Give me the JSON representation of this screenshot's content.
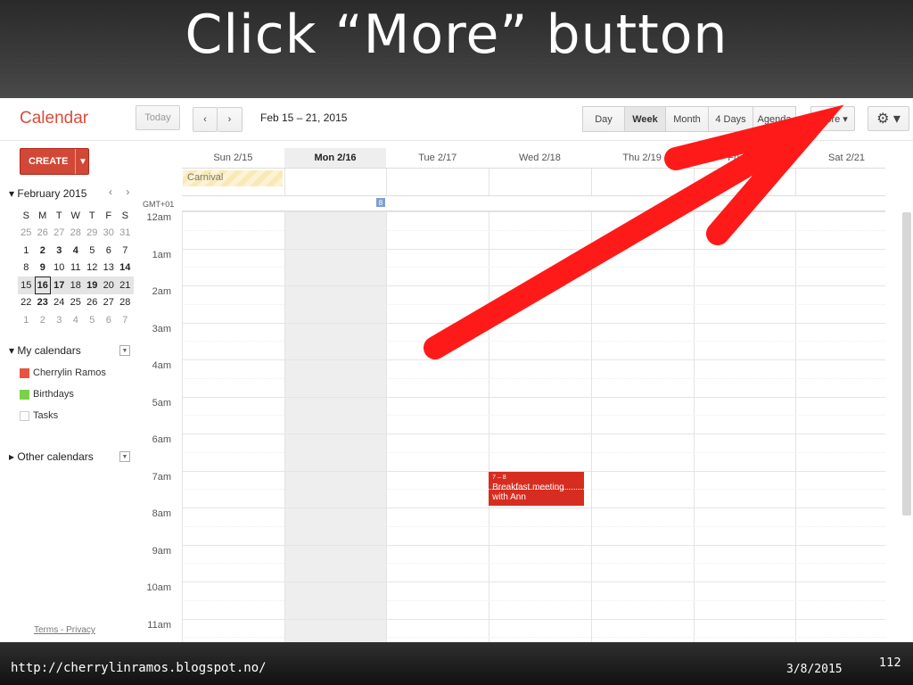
{
  "slide": {
    "title": "Click “More” button",
    "footer_url": "http://cherrylinramos.blogspot.no/",
    "footer_date": "3/8/2015",
    "page_number": "112"
  },
  "app": {
    "name": "Calendar",
    "today_label": "Today",
    "prev_icon": "‹",
    "next_icon": "›",
    "date_range": "Feb 15 – 21, 2015",
    "views": [
      "Day",
      "Week",
      "Month",
      "4 Days",
      "Agenda"
    ],
    "active_view": "Week",
    "more_label": "More ▾",
    "settings_icon": "⚙ ▾"
  },
  "sidebar": {
    "create_label": "CREATE",
    "create_arrow": "▼",
    "month_title": "▾ February 2015",
    "month_nav": "‹ ›",
    "weekday_headers": [
      "S",
      "M",
      "T",
      "W",
      "T",
      "F",
      "S"
    ],
    "weeks": [
      [
        "25",
        "26",
        "27",
        "28",
        "29",
        "30",
        "31"
      ],
      [
        "1",
        "2",
        "3",
        "4",
        "5",
        "6",
        "7"
      ],
      [
        "8",
        "9",
        "10",
        "11",
        "12",
        "13",
        "14"
      ],
      [
        "15",
        "16",
        "17",
        "18",
        "19",
        "20",
        "21"
      ],
      [
        "22",
        "23",
        "24",
        "25",
        "26",
        "27",
        "28"
      ],
      [
        "1",
        "2",
        "3",
        "4",
        "5",
        "6",
        "7"
      ]
    ],
    "my_calendars_label": "▾ My calendars",
    "calendars": [
      {
        "name": "Cherrylin Ramos",
        "color": "#e8543f"
      },
      {
        "name": "Birthdays",
        "color": "#7bd148"
      },
      {
        "name": "Tasks",
        "color": "#ffffff"
      }
    ],
    "other_calendars_label": "▸ Other calendars",
    "dropdown_icon": "▼",
    "footer_links": "Terms - Privacy"
  },
  "week": {
    "days": [
      "Sun 2/15",
      "Mon 2/16",
      "Tue 2/17",
      "Wed 2/18",
      "Thu 2/19",
      "Fri 2/20",
      "Sat 2/21"
    ],
    "selected_day_index": 1,
    "allday_event": "Carnival",
    "timezone": "GMT+01",
    "week_number": "8",
    "hours": [
      "12am",
      "1am",
      "2am",
      "3am",
      "4am",
      "5am",
      "6am",
      "7am",
      "8am",
      "9am",
      "10am",
      "11am"
    ],
    "event": {
      "time": "7 – 8",
      "title": "Breakfast meeting with Ann",
      "day_index": 3,
      "color": "#d62d20"
    }
  },
  "colors": {
    "brand_red": "#dd4b39",
    "create_red": "#d14836",
    "annotation_arrow": "#ff1a1a"
  }
}
